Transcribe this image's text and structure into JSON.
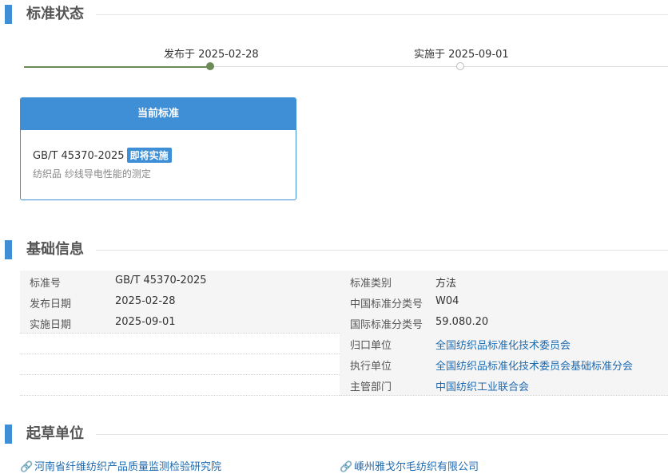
{
  "status_section": {
    "title": "标准状态",
    "published": "发布于 2025-02-28",
    "effective": "实施于 2025-09-01"
  },
  "current_card": {
    "header": "当前标准",
    "code": "GB/T 45370-2025",
    "badge": "即将实施",
    "name": "纺织品 纱线导电性能的测定"
  },
  "basic_section": {
    "title": "基础信息",
    "left_rows": [
      {
        "label": "标准号",
        "value": "GB/T 45370-2025"
      },
      {
        "label": "发布日期",
        "value": "2025-02-28"
      },
      {
        "label": "实施日期",
        "value": "2025-09-01"
      }
    ],
    "right_rows": [
      {
        "label": "标准类别",
        "value": "方法"
      },
      {
        "label": "中国标准分类号",
        "value": "W04"
      },
      {
        "label": "国际标准分类号",
        "value": "59.080.20"
      },
      {
        "label": "归口单位",
        "value": "全国纺织品标准化技术委员会"
      },
      {
        "label": "执行单位",
        "value": "全国纺织品标准化技术委员会基础标准分会"
      },
      {
        "label": "主管部门",
        "value": "中国纺织工业联合会"
      }
    ]
  },
  "drafting_section": {
    "title": "起草单位",
    "units": [
      "河南省纤维纺织产品质量监测检验研究院",
      "嵊州雅戈尔毛纺织有限公司"
    ]
  },
  "colors": {
    "accent": "#3f8fd6",
    "timeline_done": "#6b8a55",
    "link": "#1f6bb0"
  },
  "icons": {
    "unit_link": "link-icon"
  }
}
